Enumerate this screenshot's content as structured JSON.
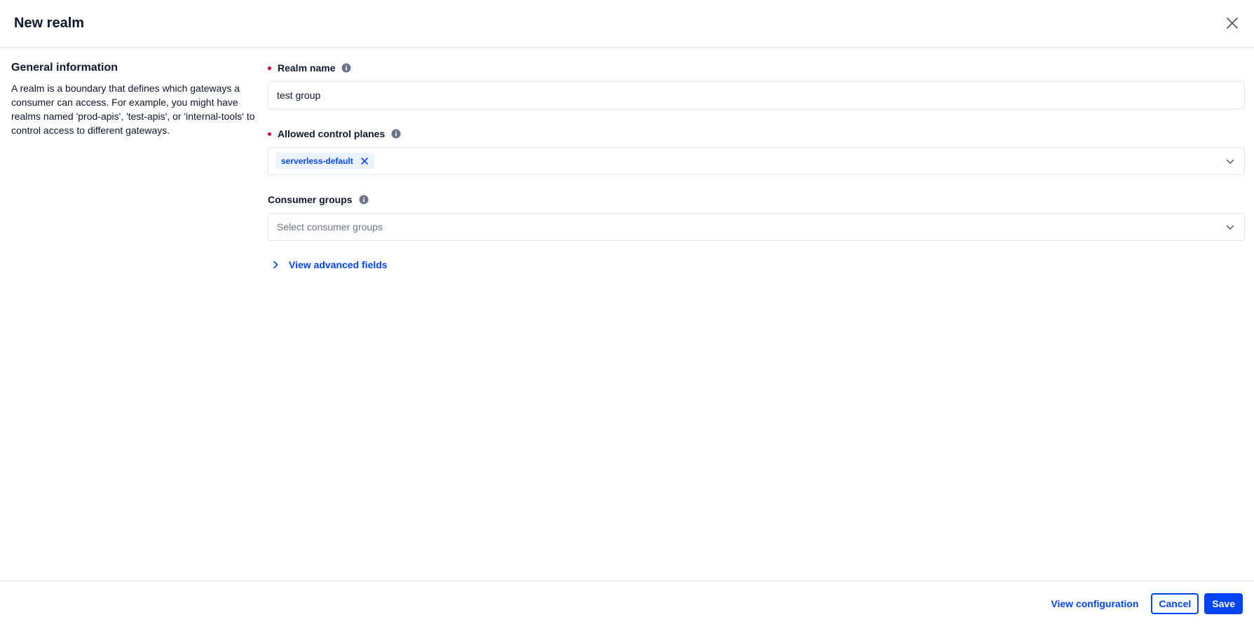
{
  "header": {
    "title": "New realm",
    "close_icon": "close-icon"
  },
  "general": {
    "heading": "General information",
    "description": "A realm is a boundary that defines which gateways a consumer can access. For example, you might have realms named 'prod-apis', 'test-apis', or 'internal-tools' to control access to different gateways."
  },
  "form": {
    "realm_name": {
      "label": "Realm name",
      "value": "test group",
      "required": true
    },
    "allowed_control_planes": {
      "label": "Allowed control planes",
      "required": true,
      "selected": [
        "serverless-default"
      ]
    },
    "consumer_groups": {
      "label": "Consumer groups",
      "placeholder": "Select consumer groups",
      "required": false
    },
    "advanced_link": "View advanced fields"
  },
  "footer": {
    "view_configuration": "View configuration",
    "cancel": "Cancel",
    "save": "Save"
  },
  "colors": {
    "primary": "#0044f4",
    "required": "#d60027",
    "text": "#0b172d",
    "border": "#e0e4ea",
    "chip_bg": "#eef4ff"
  }
}
